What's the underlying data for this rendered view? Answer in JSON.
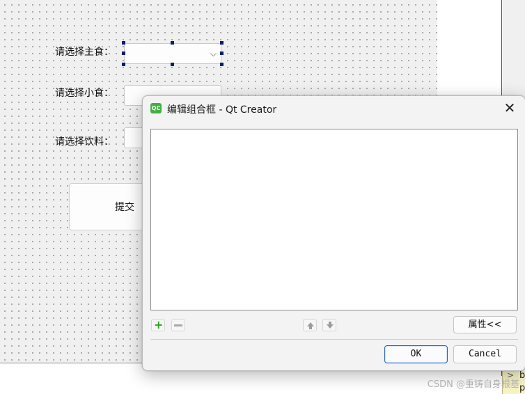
{
  "form": {
    "label_main": "请选择主食：",
    "label_snack": "请选择小食：",
    "label_drink": "请选择饮料：",
    "submit_label": "提交",
    "chevron": "⌵"
  },
  "dialog": {
    "logo_text": "QC",
    "title": "编辑组合框 - Qt Creator",
    "close_glyph": "✕",
    "add_glyph": "+",
    "properties_label": "属性<<",
    "ok_label": "OK",
    "cancel_label": "Cancel"
  },
  "side_cell": {
    "chevron": ">",
    "row1": "b",
    "row2": "p"
  },
  "watermark": "CSDN @重铸自身根基"
}
